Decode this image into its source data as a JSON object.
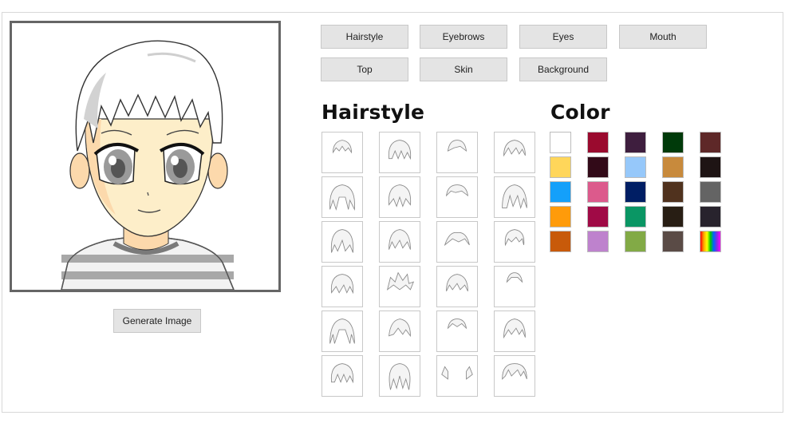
{
  "generate_button": "Generate Image",
  "tabs": [
    {
      "label": "Hairstyle"
    },
    {
      "label": "Eyebrows"
    },
    {
      "label": "Eyes"
    },
    {
      "label": "Mouth"
    },
    {
      "label": "Top"
    },
    {
      "label": "Skin"
    },
    {
      "label": "Background"
    }
  ],
  "hairstyle_heading": "Hairstyle",
  "color_heading": "Color",
  "hairstyles_count_visible": 24,
  "colors": [
    "#ffffff",
    "#9a0a2e",
    "#3e1e3e",
    "#003a0a",
    "#5e2828",
    "#ffd65a",
    "#320a18",
    "#96c8fa",
    "#c88a3c",
    "#1e1414",
    "#14a0fa",
    "#dc5a8c",
    "#001e64",
    "#50321e",
    "#646464",
    "#ff9b0a",
    "#a00a46",
    "#0a9664",
    "#281e14",
    "#28232d",
    "#c85a0a",
    "#be82cd",
    "#82aa46",
    "#5a4b46",
    "rainbow"
  ]
}
